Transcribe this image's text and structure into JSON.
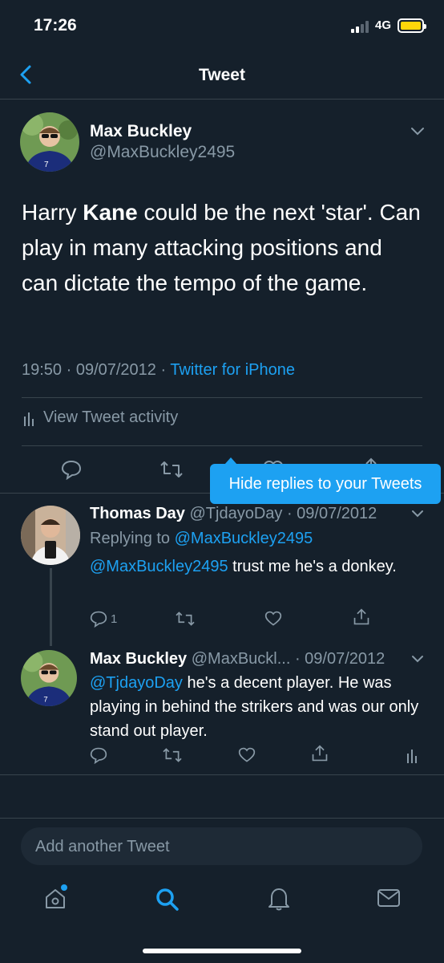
{
  "status_bar": {
    "time": "17:26",
    "network": "4G",
    "battery_color": "#ffd60a"
  },
  "nav": {
    "title": "Tweet",
    "back_icon": "chevron-left-icon"
  },
  "main_tweet": {
    "name": "Max Buckley",
    "handle": "@MaxBuckley2495",
    "text_before": "Harry ",
    "text_bold": "Kane",
    "text_after": " could be the next 'star'. Can play in many attacking positions and can dictate the tempo of the game.",
    "time": "19:50 · 09/07/2012 · ",
    "source": "Twitter for iPhone",
    "activity_label": "View Tweet activity"
  },
  "tooltip": {
    "text": "Hide replies to your Tweets"
  },
  "replies": [
    {
      "name": "Thomas Day",
      "handle_date": "@TjdayoDay · 09/07/2012",
      "replying_label": "Replying to ",
      "replying_to": "@MaxBuckley2495",
      "mention": "@MaxBuckley2495",
      "text": " trust me he's a donkey.",
      "reply_count": "1"
    },
    {
      "name": "Max Buckley",
      "handle_date": "@MaxBuckl... · 09/07/2012",
      "mention": "@TjdayoDay",
      "text": " he's a decent player. He was playing in behind the strikers and was our only stand out player."
    }
  ],
  "compose": {
    "placeholder": "Add another Tweet"
  },
  "tab_bar": [
    "home-icon",
    "search-icon",
    "notifications-icon",
    "messages-icon"
  ],
  "colors": {
    "background": "#15202b",
    "accent": "#1da1f2",
    "muted": "#8899a6",
    "border": "#38444d"
  }
}
